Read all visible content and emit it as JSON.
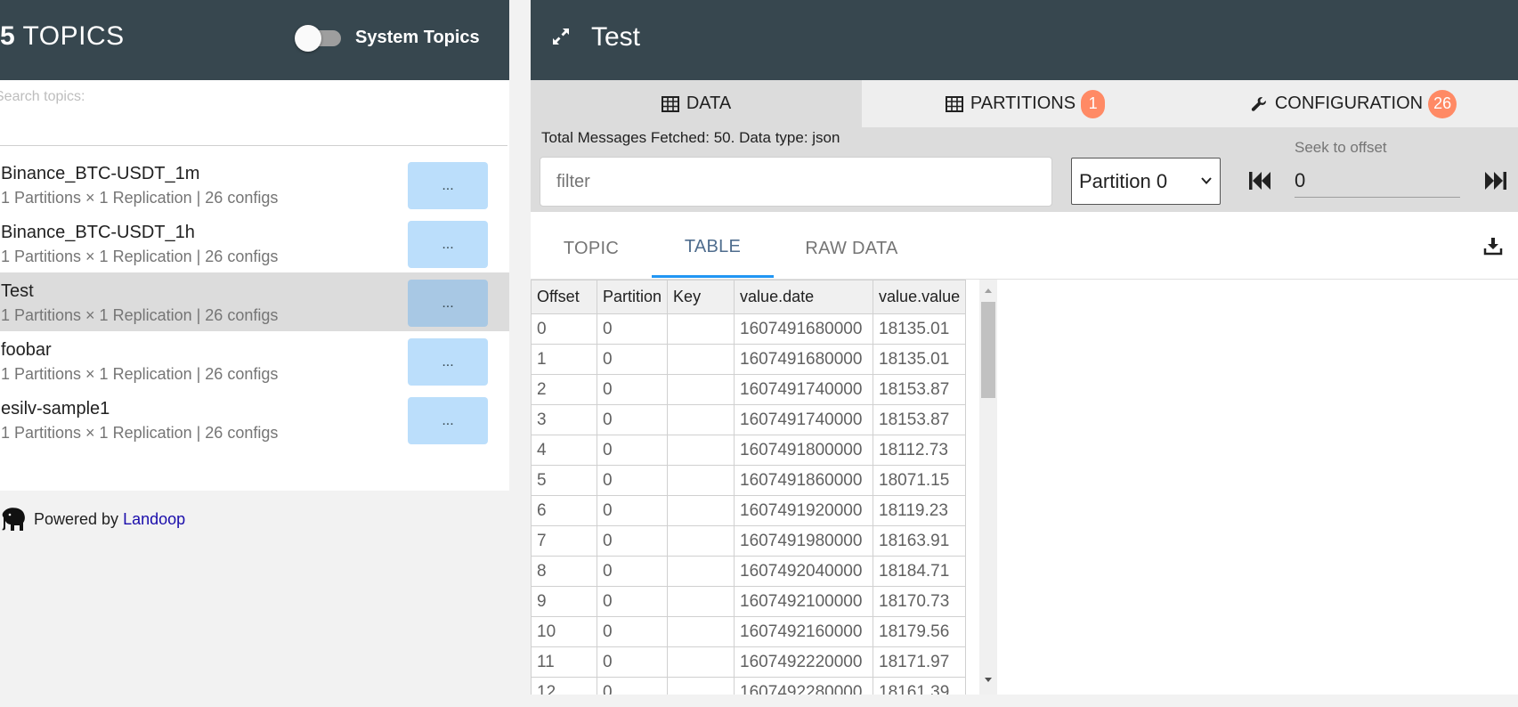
{
  "left": {
    "count": "5",
    "topics_label": " TOPICS",
    "system_topics_label": "System Topics",
    "search_placeholder": "Search topics:",
    "topics": [
      {
        "name": "Binance_BTC-USDT_1m",
        "meta": "1 Partitions × 1 Replication | 26 configs",
        "action": "...",
        "selected": false
      },
      {
        "name": "Binance_BTC-USDT_1h",
        "meta": "1 Partitions × 1 Replication | 26 configs",
        "action": "...",
        "selected": false
      },
      {
        "name": "Test",
        "meta": "1 Partitions × 1 Replication | 26 configs",
        "action": "...",
        "selected": true
      },
      {
        "name": "foobar",
        "meta": "1 Partitions × 1 Replication | 26 configs",
        "action": "...",
        "selected": false
      },
      {
        "name": "esilv-sample1",
        "meta": "1 Partitions × 1 Replication | 26 configs",
        "action": "...",
        "selected": false
      }
    ],
    "powered_by": "Powered by",
    "powered_link": "Landoop"
  },
  "right": {
    "title": "Test",
    "tabs": [
      {
        "label": "DATA",
        "icon": "table-icon",
        "badge": ""
      },
      {
        "label": "PARTITIONS",
        "icon": "table-icon",
        "badge": "1"
      },
      {
        "label": "CONFIGURATION",
        "icon": "wrench-icon",
        "badge": "26"
      }
    ],
    "fetched_text": "Total Messages Fetched: 50. Data type: json",
    "filter_placeholder": "filter",
    "partition_selected": "Partition 0",
    "seek_label": "Seek to offset",
    "seek_value": "0",
    "sub_tabs": [
      "TOPIC",
      "TABLE",
      "RAW DATA"
    ],
    "active_sub_tab": "TABLE",
    "table": {
      "columns": [
        "Offset",
        "Partition",
        "Key",
        "value.date",
        "value.value"
      ],
      "rows": [
        [
          "0",
          "0",
          "",
          "1607491680000",
          "18135.01"
        ],
        [
          "1",
          "0",
          "",
          "1607491680000",
          "18135.01"
        ],
        [
          "2",
          "0",
          "",
          "1607491740000",
          "18153.87"
        ],
        [
          "3",
          "0",
          "",
          "1607491740000",
          "18153.87"
        ],
        [
          "4",
          "0",
          "",
          "1607491800000",
          "18112.73"
        ],
        [
          "5",
          "0",
          "",
          "1607491860000",
          "18071.15"
        ],
        [
          "6",
          "0",
          "",
          "1607491920000",
          "18119.23"
        ],
        [
          "7",
          "0",
          "",
          "1607491980000",
          "18163.91"
        ],
        [
          "8",
          "0",
          "",
          "1607492040000",
          "18184.71"
        ],
        [
          "9",
          "0",
          "",
          "1607492100000",
          "18170.73"
        ],
        [
          "10",
          "0",
          "",
          "1607492160000",
          "18179.56"
        ],
        [
          "11",
          "0",
          "",
          "1607492220000",
          "18171.97"
        ],
        [
          "12",
          "0",
          "",
          "1607492280000",
          "18161.39"
        ]
      ]
    }
  },
  "colors": {
    "header_bg": "#37474f",
    "badge": "#ff8a65",
    "topic_button": "#bbdefb",
    "active_tab_underline": "#2196f3"
  }
}
